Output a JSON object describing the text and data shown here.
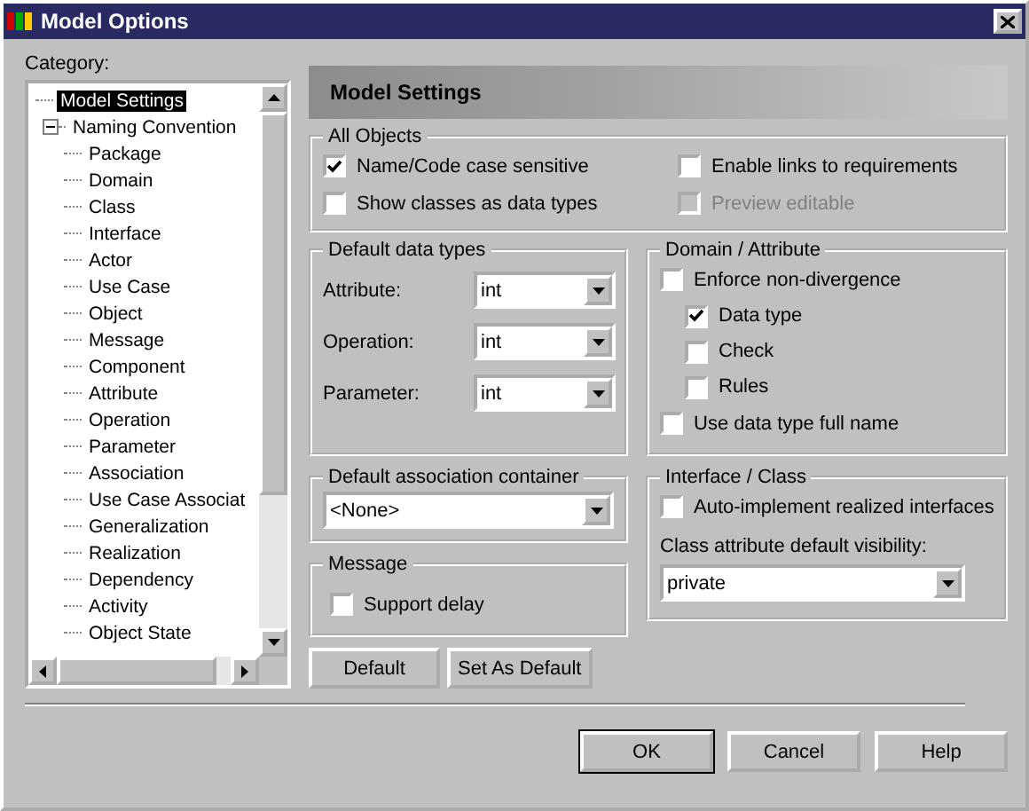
{
  "window": {
    "title": "Model Options"
  },
  "category": {
    "label": "Category:",
    "tree": [
      {
        "label": "Model Settings",
        "selected": true
      },
      {
        "label": "Naming Convention",
        "selected": false,
        "expanded": true,
        "children": [
          {
            "label": "Package",
            "selected": false
          },
          {
            "label": "Domain",
            "selected": false
          },
          {
            "label": "Class",
            "selected": false
          },
          {
            "label": "Interface",
            "selected": false
          },
          {
            "label": "Actor",
            "selected": false
          },
          {
            "label": "Use Case",
            "selected": false
          },
          {
            "label": "Object",
            "selected": false
          },
          {
            "label": "Message",
            "selected": false
          },
          {
            "label": "Component",
            "selected": false
          },
          {
            "label": "Attribute",
            "selected": false
          },
          {
            "label": "Operation",
            "selected": false
          },
          {
            "label": "Parameter",
            "selected": false
          },
          {
            "label": "Association",
            "selected": false
          },
          {
            "label": "Use Case Associat",
            "selected": false
          },
          {
            "label": "Generalization",
            "selected": false
          },
          {
            "label": "Realization",
            "selected": false
          },
          {
            "label": "Dependency",
            "selected": false
          },
          {
            "label": "Activity",
            "selected": false
          },
          {
            "label": "Object State",
            "selected": false
          }
        ]
      }
    ]
  },
  "header": "Model Settings",
  "all_objects": {
    "title": "All Objects",
    "options": [
      {
        "label": "Name/Code case sensitive",
        "checked": true,
        "disabled": false
      },
      {
        "label": "Enable links to requirements",
        "checked": false,
        "disabled": false
      },
      {
        "label": "Show classes as data types",
        "checked": false,
        "disabled": false
      },
      {
        "label": "Preview editable",
        "checked": false,
        "disabled": true
      }
    ]
  },
  "default_data_types": {
    "title": "Default data types",
    "fields": [
      {
        "label": "Attribute:",
        "value": "int"
      },
      {
        "label": "Operation:",
        "value": "int"
      },
      {
        "label": "Parameter:",
        "value": "int"
      }
    ]
  },
  "domain_attribute": {
    "title": "Domain / Attribute",
    "options": [
      {
        "label": "Enforce non-divergence",
        "checked": false,
        "children": [
          {
            "label": "Data type",
            "checked": true
          },
          {
            "label": "Check",
            "checked": false
          },
          {
            "label": "Rules",
            "checked": false
          }
        ]
      },
      {
        "label": "Use data type full name",
        "checked": false
      }
    ]
  },
  "default_association_container": {
    "title": "Default association container",
    "value": "<None>"
  },
  "message": {
    "title": "Message",
    "options": [
      {
        "label": "Support delay",
        "checked": false
      }
    ]
  },
  "interface_class": {
    "title": "Interface / Class",
    "options": [
      {
        "label": "Auto-implement realized interfaces",
        "checked": false
      }
    ],
    "visibility_label": "Class attribute default visibility:",
    "visibility": "private"
  },
  "panel_buttons": [
    "Default",
    "Set As Default"
  ],
  "buttons": [
    {
      "label": "OK",
      "default": true
    },
    {
      "label": "Cancel",
      "default": false
    },
    {
      "label": "Help",
      "default": false
    }
  ]
}
